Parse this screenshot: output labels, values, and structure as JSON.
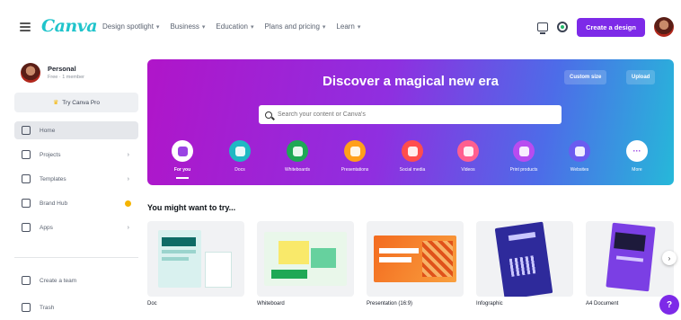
{
  "topbar": {
    "logo": "Canva",
    "nav": [
      {
        "label": "Design spotlight"
      },
      {
        "label": "Business"
      },
      {
        "label": "Education"
      },
      {
        "label": "Plans and pricing"
      },
      {
        "label": "Learn"
      }
    ],
    "chevron": "▾",
    "create_label": "Create a design"
  },
  "sidebar": {
    "account_name": "Personal",
    "account_sub": "Free · 1 member",
    "pro_label": "Try Canva Pro",
    "items": [
      {
        "label": "Home",
        "icon": "home-icon"
      },
      {
        "label": "Projects",
        "icon": "folder-icon"
      },
      {
        "label": "Templates",
        "icon": "templates-icon"
      },
      {
        "label": "Brand Hub",
        "icon": "brand-icon"
      },
      {
        "label": "Apps",
        "icon": "apps-icon"
      }
    ],
    "bottom_items": [
      {
        "label": "Create a team",
        "icon": "team-icon"
      },
      {
        "label": "Trash",
        "icon": "trash-icon"
      }
    ]
  },
  "hero": {
    "title": "Discover a magical new era",
    "custom_size_label": "Custom size",
    "upload_label": "Upload",
    "search_placeholder": "Search your content or Canva's",
    "categories": [
      {
        "label": "For you",
        "color": "#ffffff",
        "icon_color": "#8f2fe0"
      },
      {
        "label": "Docs",
        "color": "#1fb8c3"
      },
      {
        "label": "Whiteboards",
        "color": "#1fa855"
      },
      {
        "label": "Presentations",
        "color": "#ff9f1a"
      },
      {
        "label": "Social media",
        "color": "#ff4d4d"
      },
      {
        "label": "Videos",
        "color": "#ff5f8f"
      },
      {
        "label": "Print products",
        "color": "#b84cf0"
      },
      {
        "label": "Websites",
        "color": "#6a5cf0"
      },
      {
        "label": "More",
        "color": "#ffffff"
      }
    ]
  },
  "suggestions": {
    "title": "You might want to try...",
    "cards": [
      {
        "label": "Doc"
      },
      {
        "label": "Whiteboard"
      },
      {
        "label": "Presentation (16:9)"
      },
      {
        "label": "Infographic"
      },
      {
        "label": "A4 Document"
      }
    ]
  },
  "help": "?",
  "arrow": "›"
}
